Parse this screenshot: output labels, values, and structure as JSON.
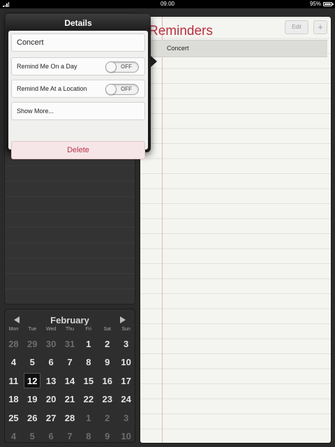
{
  "status_bar": {
    "time": "09.00",
    "battery": "95%"
  },
  "reminders": {
    "title": "Reminders",
    "edit_label": "Edit",
    "add_label": "+",
    "items": [
      "Concert"
    ]
  },
  "details": {
    "title": "Details",
    "name_value": "Concert",
    "remind_day_label": "Remind Me On a Day",
    "remind_day_state": "OFF",
    "remind_location_label": "Remind Me At a Location",
    "remind_location_state": "OFF",
    "show_more_label": "Show More...",
    "delete_label": "Delete"
  },
  "calendar": {
    "month": "February",
    "weekdays": [
      "Mon",
      "Tue",
      "Wed",
      "Thu",
      "Fri",
      "Sat",
      "Sun"
    ],
    "weeks": [
      [
        {
          "d": "28",
          "o": true
        },
        {
          "d": "29",
          "o": true
        },
        {
          "d": "30",
          "o": true
        },
        {
          "d": "31",
          "o": true
        },
        {
          "d": "1"
        },
        {
          "d": "2"
        },
        {
          "d": "3"
        }
      ],
      [
        {
          "d": "4"
        },
        {
          "d": "5"
        },
        {
          "d": "6"
        },
        {
          "d": "7"
        },
        {
          "d": "8"
        },
        {
          "d": "9"
        },
        {
          "d": "10"
        }
      ],
      [
        {
          "d": "11"
        },
        {
          "d": "12",
          "today": true
        },
        {
          "d": "13"
        },
        {
          "d": "14"
        },
        {
          "d": "15"
        },
        {
          "d": "16"
        },
        {
          "d": "17"
        }
      ],
      [
        {
          "d": "18"
        },
        {
          "d": "19"
        },
        {
          "d": "20"
        },
        {
          "d": "21"
        },
        {
          "d": "22"
        },
        {
          "d": "23"
        },
        {
          "d": "24"
        }
      ],
      [
        {
          "d": "25"
        },
        {
          "d": "26"
        },
        {
          "d": "27"
        },
        {
          "d": "28"
        },
        {
          "d": "1",
          "o": true
        },
        {
          "d": "2",
          "o": true
        },
        {
          "d": "3",
          "o": true
        }
      ],
      [
        {
          "d": "4",
          "o": true
        },
        {
          "d": "5",
          "o": true
        },
        {
          "d": "6",
          "o": true
        },
        {
          "d": "7",
          "o": true
        },
        {
          "d": "8",
          "o": true
        },
        {
          "d": "9",
          "o": true
        },
        {
          "d": "10",
          "o": true
        }
      ]
    ]
  },
  "colors": {
    "accent_red": "#b83040",
    "delete_red": "#b8314a"
  }
}
